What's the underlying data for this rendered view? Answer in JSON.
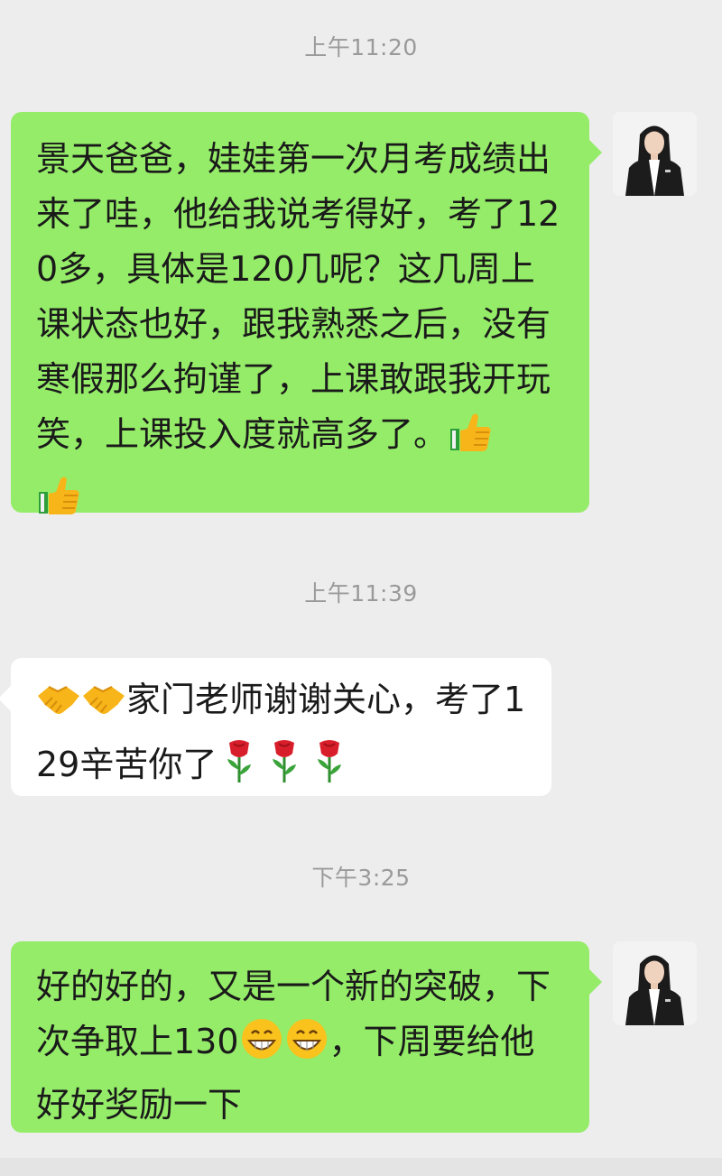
{
  "messages": [
    {
      "timestamp": "上午11:20",
      "side": "right",
      "text": "景天爸爸，娃娃第一次月考成绩出来了哇，他给我说考得好，考了120多，具体是120几呢？这几周上课状态也好，跟我熟悉之后，没有寒假那么拘谨了，上课敢跟我开玩笑，上课投入度就高多了。",
      "trailing_emojis": [
        "thumbs-up-icon",
        "thumbs-up-icon"
      ]
    },
    {
      "timestamp": "上午11:39",
      "side": "left",
      "leading_emojis": [
        "handshake-icon",
        "handshake-icon"
      ],
      "text": "家门老师谢谢关心，考了129辛苦你了",
      "trailing_emojis": [
        "rose-icon",
        "rose-icon",
        "rose-icon"
      ]
    },
    {
      "timestamp": "下午3:25",
      "side": "right",
      "text_part1": "好的好的，又是一个新的突破，下次争取上130",
      "mid_emojis": [
        "grin-icon",
        "grin-icon"
      ],
      "text_part2": "，下周要给他好好奖励一下"
    }
  ],
  "colors": {
    "background": "#ededed",
    "outgoing_bubble": "#95ec69",
    "incoming_bubble": "#ffffff",
    "timestamp_text": "#9a9a9a",
    "message_text": "#1a1a1a"
  }
}
